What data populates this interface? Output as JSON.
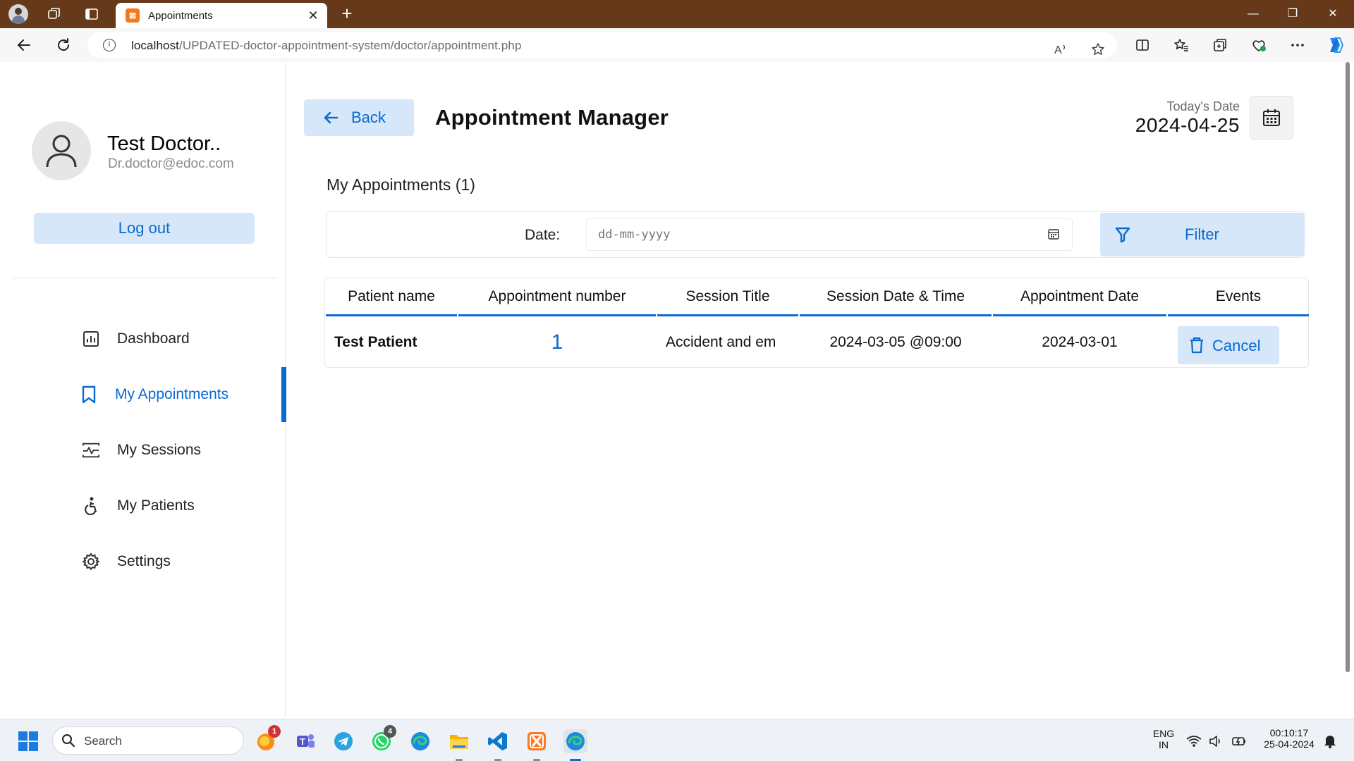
{
  "browser": {
    "tab_title": "Appointments",
    "tab_favicon": "XAMPP",
    "url_host": "localhost",
    "url_path": "/UPDATED-doctor-appointment-system/doctor/appointment.php"
  },
  "sidebar": {
    "doctor_name": "Test Doctor..",
    "doctor_email": "Dr.doctor@edoc.com",
    "logout_label": "Log out",
    "items": [
      {
        "label": "Dashboard",
        "icon": "dashboard-icon",
        "active": false
      },
      {
        "label": "My Appointments",
        "icon": "bookmark-icon",
        "active": true
      },
      {
        "label": "My Sessions",
        "icon": "sessions-icon",
        "active": false
      },
      {
        "label": "My Patients",
        "icon": "accessibility-icon",
        "active": false
      },
      {
        "label": "Settings",
        "icon": "gear-icon",
        "active": false
      }
    ]
  },
  "header": {
    "back_label": "Back",
    "title": "Appointment Manager",
    "today_label": "Today's Date",
    "today_value": "2024-04-25"
  },
  "main": {
    "section_title": "My Appointments (1)",
    "filter": {
      "date_label": "Date:",
      "date_placeholder": "dd-mm-yyyy",
      "filter_label": "Filter"
    },
    "table": {
      "columns": [
        "Patient name",
        "Appointment number",
        "Session Title",
        "Session Date & Time",
        "Appointment Date",
        "Events"
      ],
      "rows": [
        {
          "patient": "Test Patient",
          "number": "1",
          "session_title": "Accident and em",
          "session_datetime": "2024-03-05 @09:00",
          "appointment_date": "2024-03-01",
          "action": "Cancel"
        }
      ]
    }
  },
  "taskbar": {
    "search_label": "Search",
    "badges": {
      "firefox": "1",
      "whatsapp": "4"
    },
    "lang_line1": "ENG",
    "lang_line2": "IN",
    "time": "00:10:17",
    "date": "25-04-2024"
  },
  "colors": {
    "accent": "#0a6ad0",
    "accent_light": "#d5e7f9",
    "titlebar": "#65391a"
  }
}
